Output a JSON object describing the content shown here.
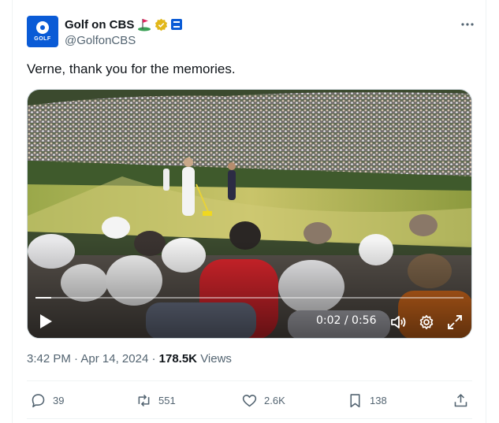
{
  "account": {
    "display_name": "Golf on CBS",
    "handle": "@GolfonCBS",
    "avatar_text": "GOLF",
    "badges": [
      "flag-icon",
      "verified-gold-icon",
      "affiliate-badge-icon"
    ]
  },
  "tweet": {
    "text": "Verne, thank you for the memories."
  },
  "video": {
    "time": "0:02 / 0:56",
    "progress": 0.036
  },
  "meta": {
    "time": "3:42 PM",
    "separator": "·",
    "date": "Apr 14, 2024",
    "views_count": "178.5K",
    "views_label": "Views"
  },
  "actions": {
    "replies": "39",
    "reposts": "551",
    "likes": "2.6K",
    "bookmarks": "138"
  },
  "colors": {
    "accent": "#1d9bf0",
    "muted_text": "#536471",
    "verified_gold": "#e2b719"
  }
}
